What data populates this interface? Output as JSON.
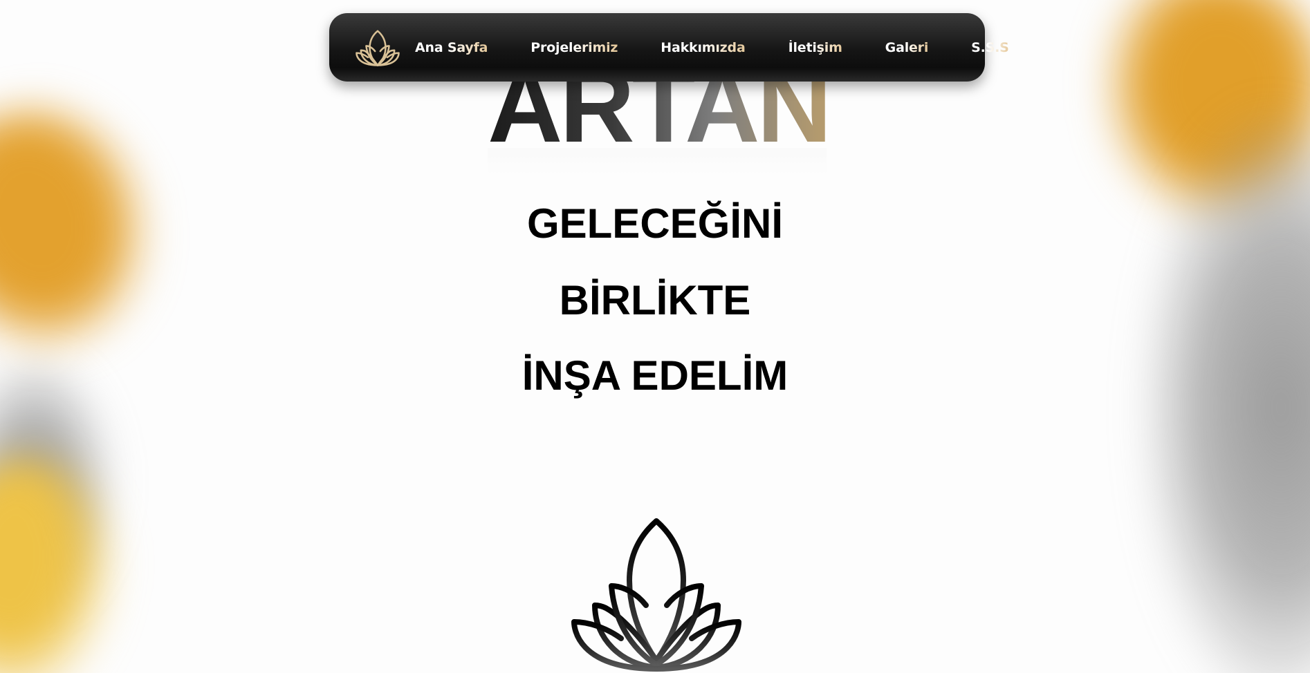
{
  "nav": {
    "logo_icon": "lotus-icon",
    "links": [
      {
        "label": "Ana Sayfa"
      },
      {
        "label": "Projelerimiz"
      },
      {
        "label": "Hakkımızda"
      },
      {
        "label": "İletişim"
      },
      {
        "label": "Galeri"
      },
      {
        "label": "S.S.S"
      }
    ]
  },
  "hero": {
    "brand": "ARTAND",
    "tagline": [
      "GELECEĞİNİ",
      "BİRLİKTE",
      "İNŞA EDELİM"
    ],
    "emblem_icon": "lotus-icon"
  },
  "colors": {
    "accent_gold": "#e5c89a",
    "accent_orange": "#e3a12e",
    "navbar_dark": "#151515",
    "text": "#000000"
  }
}
